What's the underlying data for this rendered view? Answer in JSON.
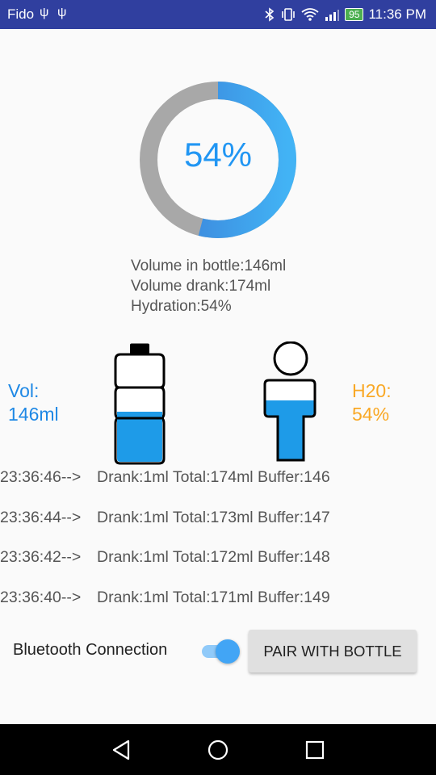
{
  "status_bar": {
    "carrier": "Fido",
    "battery": "95",
    "time": "11:36 PM"
  },
  "progress": {
    "percent_label": "54%",
    "fraction": 0.54
  },
  "stats": {
    "volume_in_bottle": "Volume in bottle:146ml",
    "volume_drank": "Volume drank:174ml",
    "hydration": "Hydration:54%"
  },
  "left_indicator": {
    "label": "Vol:",
    "value": "146ml"
  },
  "right_indicator": {
    "label": "H20:",
    "value": "54%"
  },
  "log": [
    {
      "time": "23:36:46-->",
      "message": "Drank:1ml Total:174ml Buffer:146"
    },
    {
      "time": "23:36:44-->",
      "message": "Drank:1ml Total:173ml Buffer:147"
    },
    {
      "time": "23:36:42-->",
      "message": "Drank:1ml Total:172ml Buffer:148"
    },
    {
      "time": "23:36:40-->",
      "message": "Drank:1ml Total:171ml Buffer:149"
    }
  ],
  "bluetooth": {
    "label": "Bluetooth Connection",
    "enabled": true,
    "pair_button": "PAIR WITH BOTTLE"
  },
  "colors": {
    "accent": "#2196f3",
    "status_bar": "#303f9f",
    "water": "#1e9be8",
    "hydration": "#f9a825",
    "ring_track": "#a8a8a8"
  },
  "icons": [
    "usb-icon",
    "bluetooth-icon",
    "vibrate-icon",
    "wifi-icon",
    "signal-icon",
    "battery-icon",
    "back-icon",
    "home-icon",
    "recents-icon"
  ]
}
